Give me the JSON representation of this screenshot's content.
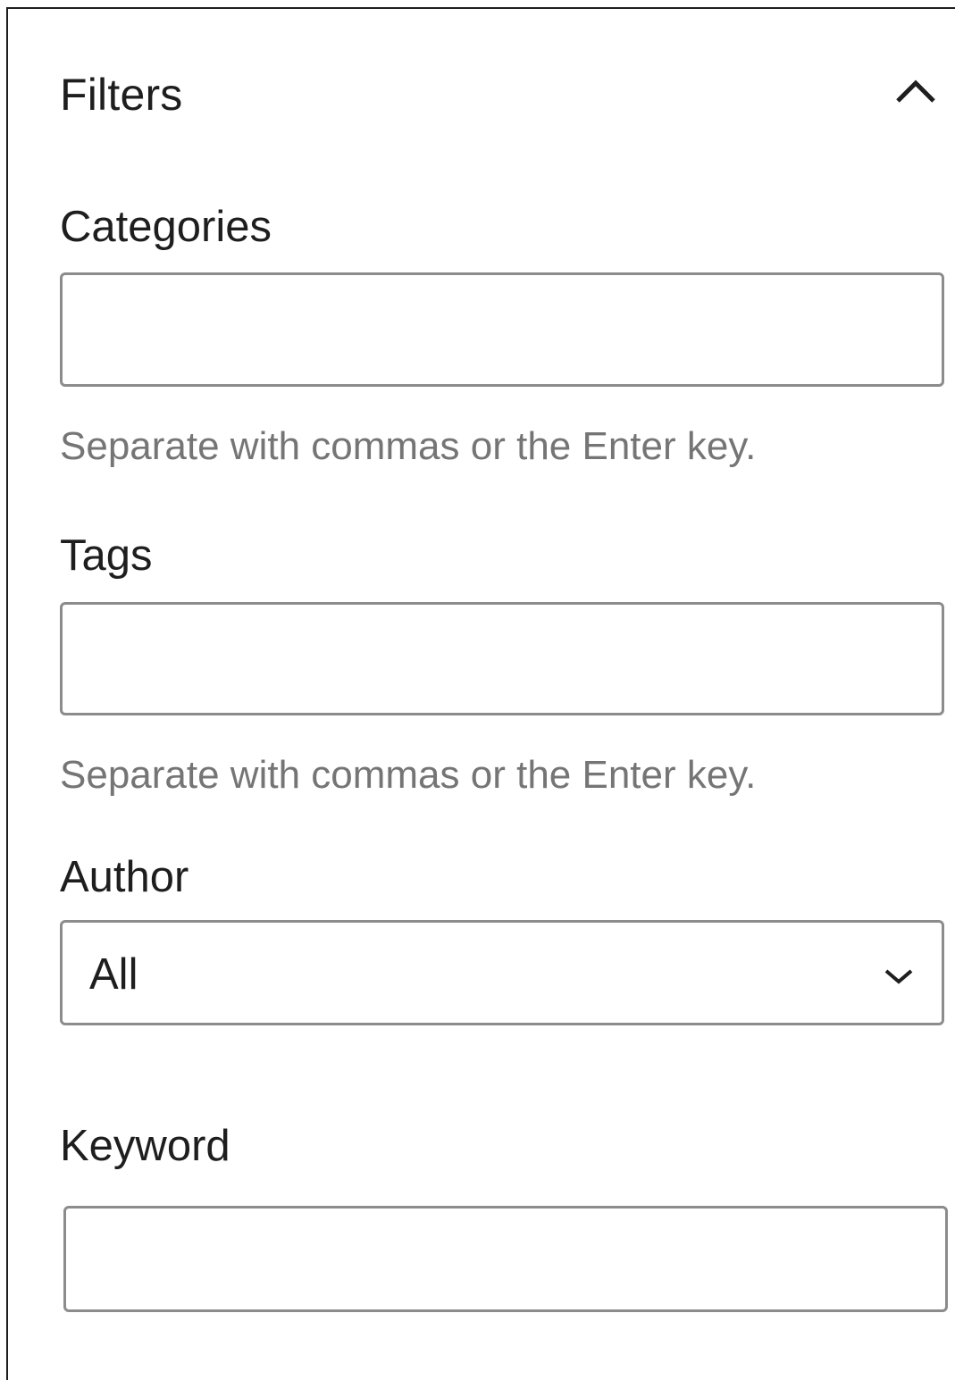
{
  "panel": {
    "title": "Filters",
    "expanded": true
  },
  "categories": {
    "label": "Categories",
    "value": "",
    "placeholder": "",
    "help": "Separate with commas or the Enter key."
  },
  "tags": {
    "label": "Tags",
    "value": "",
    "placeholder": "",
    "help": "Separate with commas or the Enter key."
  },
  "author": {
    "label": "Author",
    "selected": "All"
  },
  "keyword": {
    "label": "Keyword",
    "value": "",
    "placeholder": ""
  },
  "icons": {
    "collapse": "chevron-up-icon",
    "select": "chevron-down-icon"
  },
  "colors": {
    "text": "#1e1e1e",
    "help_text": "#757575",
    "input_border": "#8c8c8c"
  }
}
